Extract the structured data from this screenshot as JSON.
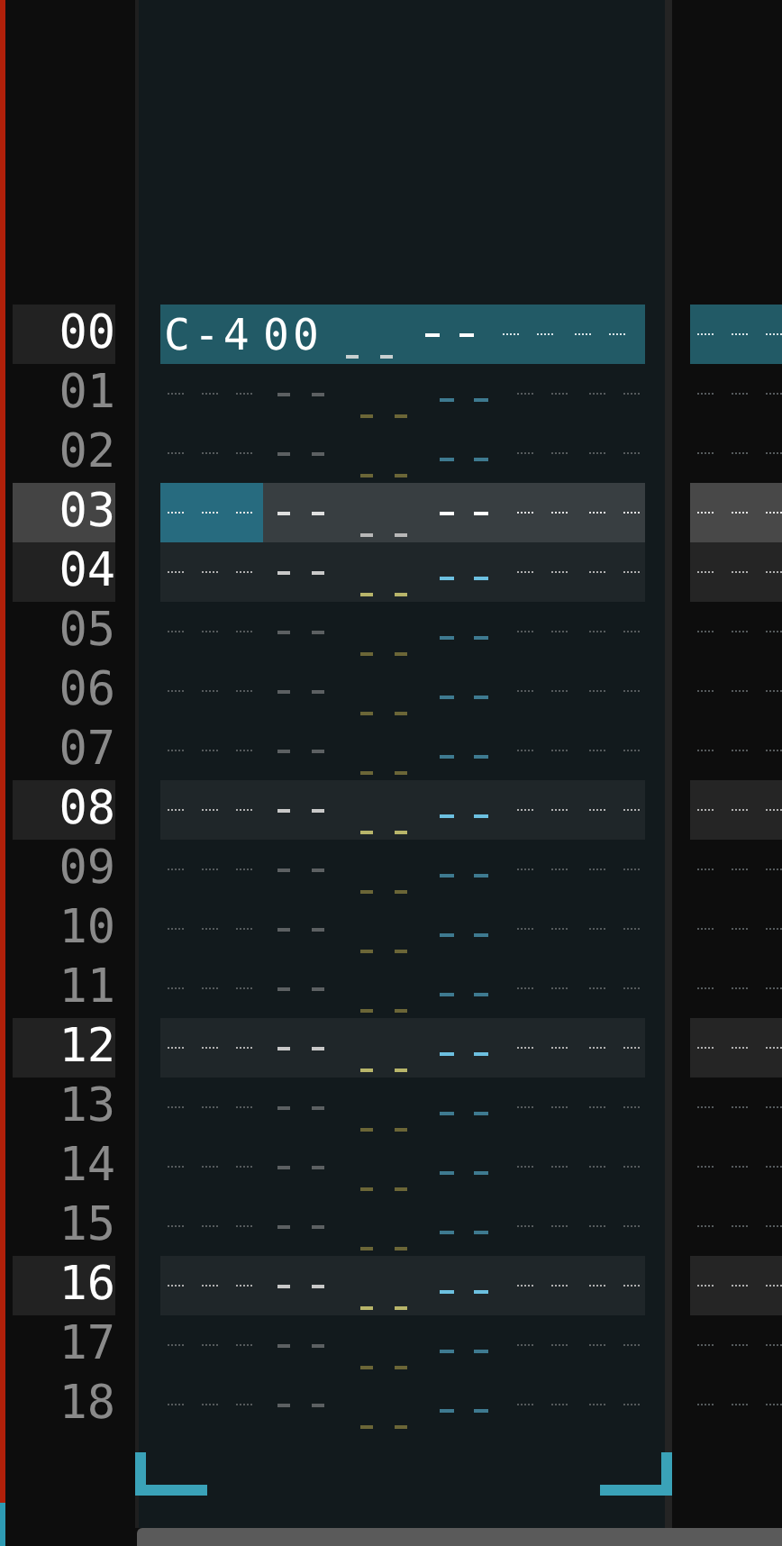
{
  "rows": [
    {
      "number": "00",
      "highlighted": true,
      "playing": true,
      "cursor": false,
      "note": "C-4",
      "instrument": "00"
    },
    {
      "number": "01",
      "highlighted": false,
      "playing": false,
      "cursor": false
    },
    {
      "number": "02",
      "highlighted": false,
      "playing": false,
      "cursor": false
    },
    {
      "number": "03",
      "highlighted": false,
      "playing": false,
      "cursor": true
    },
    {
      "number": "04",
      "highlighted": true,
      "playing": false,
      "cursor": false
    },
    {
      "number": "05",
      "highlighted": false,
      "playing": false,
      "cursor": false
    },
    {
      "number": "06",
      "highlighted": false,
      "playing": false,
      "cursor": false
    },
    {
      "number": "07",
      "highlighted": false,
      "playing": false,
      "cursor": false
    },
    {
      "number": "08",
      "highlighted": true,
      "playing": false,
      "cursor": false
    },
    {
      "number": "09",
      "highlighted": false,
      "playing": false,
      "cursor": false
    },
    {
      "number": "10",
      "highlighted": false,
      "playing": false,
      "cursor": false
    },
    {
      "number": "11",
      "highlighted": false,
      "playing": false,
      "cursor": false
    },
    {
      "number": "12",
      "highlighted": true,
      "playing": false,
      "cursor": false
    },
    {
      "number": "13",
      "highlighted": false,
      "playing": false,
      "cursor": false
    },
    {
      "number": "14",
      "highlighted": false,
      "playing": false,
      "cursor": false
    },
    {
      "number": "15",
      "highlighted": false,
      "playing": false,
      "cursor": false
    },
    {
      "number": "16",
      "highlighted": true,
      "playing": false,
      "cursor": false
    },
    {
      "number": "17",
      "highlighted": false,
      "playing": false,
      "cursor": false
    },
    {
      "number": "18",
      "highlighted": false,
      "playing": false,
      "cursor": false
    }
  ]
}
